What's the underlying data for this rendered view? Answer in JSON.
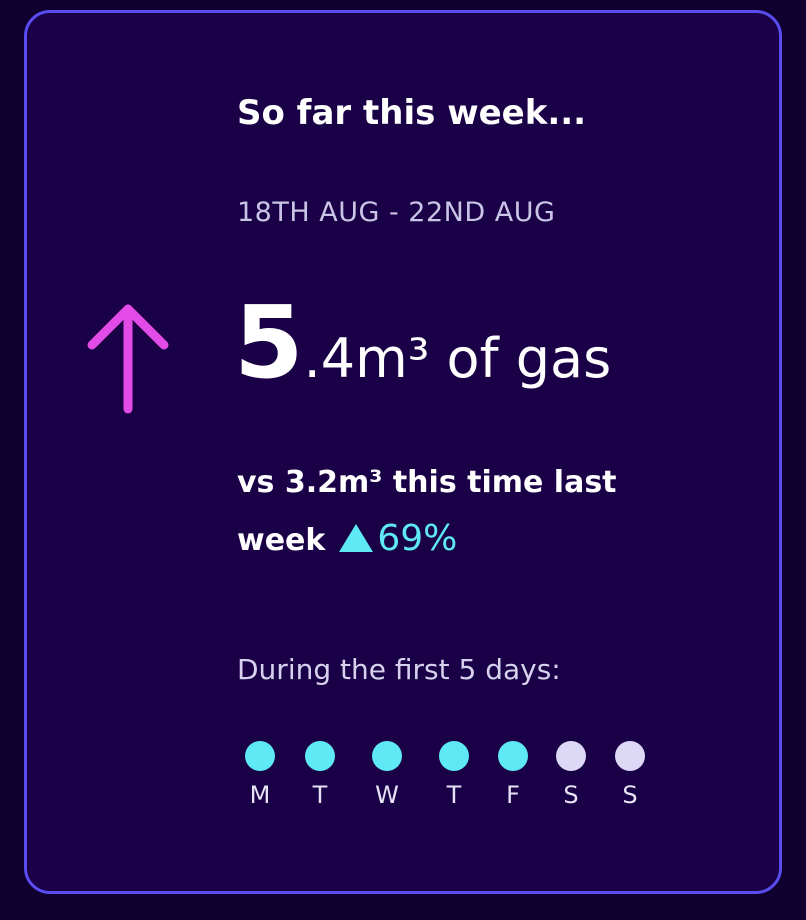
{
  "card": {
    "heading": "So far this week...",
    "date_range": "18TH AUG - 22ND AUG",
    "trend_icon": "arrow-up-icon",
    "usage": {
      "whole": "5",
      "rest": ".4m³ of gas"
    },
    "comparison": {
      "text_line1": "vs 3.2m³ this time last",
      "text_line2": "week",
      "change_icon": "triangle-up-icon",
      "percent": "69%"
    },
    "days_label": "During the first 5 days:",
    "days": [
      {
        "letter": "M",
        "active": true
      },
      {
        "letter": "T",
        "active": true
      },
      {
        "letter": "W",
        "active": true
      },
      {
        "letter": "T",
        "active": true
      },
      {
        "letter": "F",
        "active": true
      },
      {
        "letter": "S",
        "active": false
      },
      {
        "letter": "S",
        "active": false
      }
    ],
    "colors": {
      "background": "#1a0046",
      "border": "#5a4df0",
      "arrow": "#e24be6",
      "accent": "#5ee9f5",
      "inactive_dot": "#dcd8f6"
    }
  }
}
